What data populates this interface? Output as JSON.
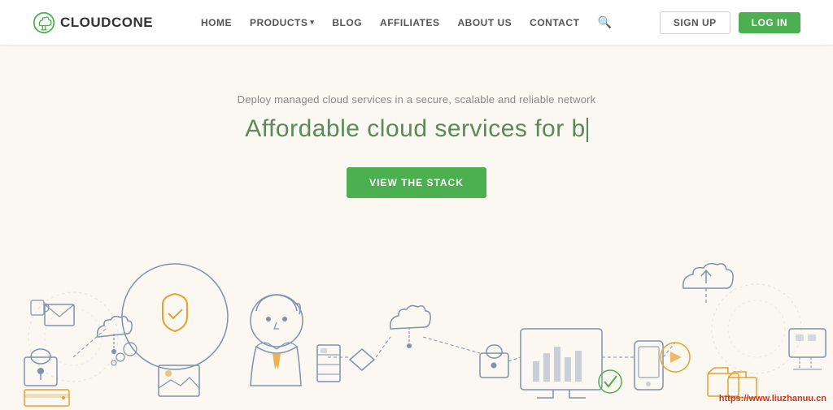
{
  "header": {
    "logo_text": "CLOUDCONE",
    "nav_items": [
      {
        "label": "HOME",
        "id": "home"
      },
      {
        "label": "PRODUCTS",
        "id": "products",
        "has_arrow": true
      },
      {
        "label": "BLOG",
        "id": "blog"
      },
      {
        "label": "AFFILIATES",
        "id": "affiliates"
      },
      {
        "label": "ABOUT US",
        "id": "about"
      },
      {
        "label": "CONTACT",
        "id": "contact"
      }
    ],
    "signup_label": "SIGN UP",
    "login_label": "LOG IN"
  },
  "hero": {
    "subtitle": "Deploy managed cloud services in a secure, scalable and reliable network",
    "title_prefix": "Affordable cloud services for b",
    "cta_label": "VIEW THE STACK"
  },
  "watermark": {
    "text": "https://www.liuzhanuu.cn"
  }
}
